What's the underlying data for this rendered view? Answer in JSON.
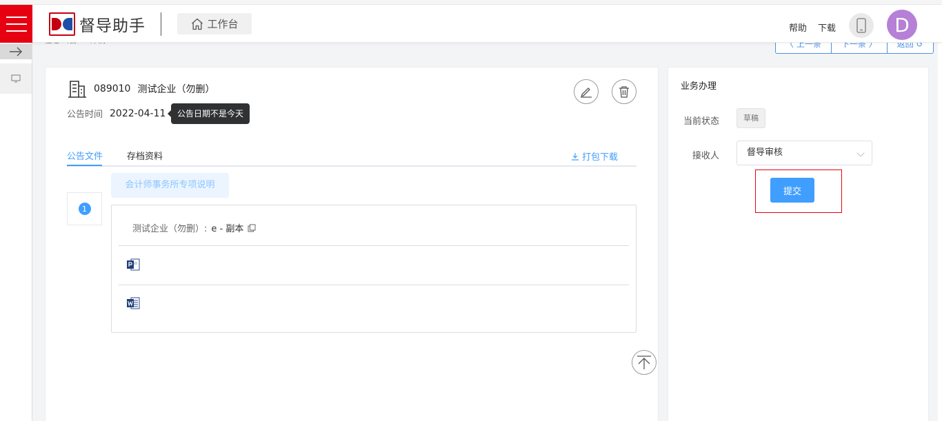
{
  "header": {
    "app_title": "督导助手",
    "workbench_label": "工作台",
    "help_label": "帮助",
    "download_label": "下载",
    "avatar_letter": "D"
  },
  "breadcrumb": {
    "text": "信息公告 > 详情"
  },
  "pager": {
    "prev_label": "〈 上一条",
    "next_label": "下一条 〉",
    "back_label": "返回 ↺"
  },
  "detail": {
    "company_code": "089010",
    "company_name": "测试企业（勿删）",
    "time_label": "公告时间",
    "time_value": "2022-04-11",
    "tooltip_text": "公告日期不是今天"
  },
  "tabs": [
    {
      "label": "公告文件",
      "active": true
    },
    {
      "label": "存档资料",
      "active": false
    }
  ],
  "download_all_label": "打包下载",
  "document": {
    "step_number": "1",
    "title": "会计师事务所专项说明",
    "file_owner": "测试企业（勿删）:",
    "file_name": "e - 副本",
    "files": [
      {
        "type": "powerpoint",
        "icon": "ppt-file-icon"
      },
      {
        "type": "word",
        "icon": "word-file-icon"
      }
    ]
  },
  "business": {
    "title": "业务办理",
    "status_label": "当前状态",
    "status_value": "草稿",
    "receiver_label": "接收人",
    "receiver_value": "督导审核",
    "submit_label": "提交"
  },
  "colors": {
    "brand_red": "#e60012",
    "primary_blue": "#409eff",
    "avatar_purple": "#b580d6"
  }
}
